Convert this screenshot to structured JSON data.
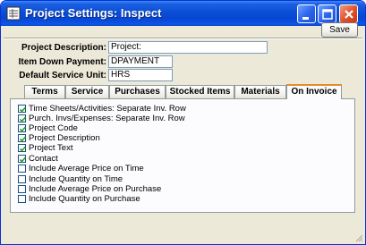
{
  "window": {
    "title": "Project Settings: Inspect",
    "icon": "document-grid-icon"
  },
  "toolbar": {
    "save_label": "Save"
  },
  "fields": [
    {
      "label": "Project Description:",
      "value": "Project:"
    },
    {
      "label": "Item Down Payment:",
      "value": "DPAYMENT"
    },
    {
      "label": "Default Service Unit:",
      "value": "HRS"
    }
  ],
  "tabs": [
    {
      "label": "Terms",
      "active": false
    },
    {
      "label": "Service",
      "active": false
    },
    {
      "label": "Purchases",
      "active": false
    },
    {
      "label": "Stocked Items",
      "active": false
    },
    {
      "label": "Materials",
      "active": false
    },
    {
      "label": "On Invoice",
      "active": true
    }
  ],
  "options": [
    {
      "label": "Time Sheets/Activities: Separate Inv. Row",
      "checked": true
    },
    {
      "label": "Purch. Invs/Expenses: Separate Inv. Row",
      "checked": true
    },
    {
      "label": "Project Code",
      "checked": true
    },
    {
      "label": "Project Description",
      "checked": true
    },
    {
      "label": "Project Text",
      "checked": true
    },
    {
      "label": "Contact",
      "checked": true
    },
    {
      "label": "Include Average Price on Time",
      "checked": false
    },
    {
      "label": "Include Quantity on Time",
      "checked": false
    },
    {
      "label": "Include Average Price on Purchase",
      "checked": false
    },
    {
      "label": "Include Quantity on Purchase",
      "checked": false
    }
  ],
  "colors": {
    "titlebar": "#0a4fd8",
    "close_button": "#e0502a",
    "active_tab_accent": "#e68b2c",
    "window_background": "#ece9d8",
    "checkmark": "#21a121"
  }
}
